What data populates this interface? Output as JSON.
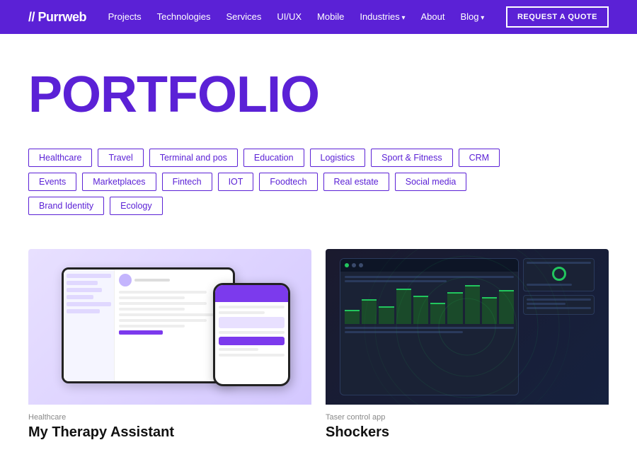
{
  "nav": {
    "logo": "// Purrweb",
    "links": [
      {
        "label": "Projects",
        "hasDropdown": false
      },
      {
        "label": "Technologies",
        "hasDropdown": false
      },
      {
        "label": "Services",
        "hasDropdown": false
      },
      {
        "label": "UI/UX",
        "hasDropdown": false
      },
      {
        "label": "Mobile",
        "hasDropdown": false
      },
      {
        "label": "Industries",
        "hasDropdown": true
      },
      {
        "label": "About",
        "hasDropdown": false
      },
      {
        "label": "Blog",
        "hasDropdown": true
      }
    ],
    "cta": "REQUEST A QUOTE"
  },
  "hero": {
    "title": "PORTFOLIO"
  },
  "filters": {
    "row1": [
      "Healthcare",
      "Travel",
      "Terminal and pos",
      "Education",
      "Logistics",
      "Sport & Fitness",
      "CRM"
    ],
    "row2": [
      "Events",
      "Marketplaces",
      "Fintech",
      "IOT",
      "Foodtech",
      "Real estate",
      "Social media"
    ],
    "row3": [
      "Brand Identity",
      "Ecology"
    ]
  },
  "cards": [
    {
      "category": "Healthcare",
      "title": "My Therapy Assistant"
    },
    {
      "category": "Taser control app",
      "title": "Shockers"
    }
  ]
}
